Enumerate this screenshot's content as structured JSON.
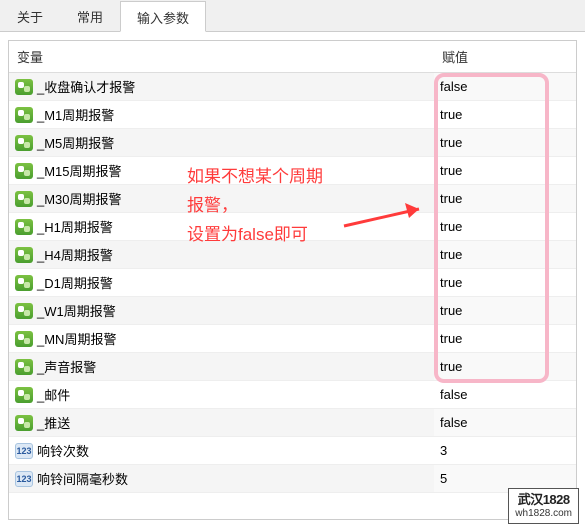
{
  "tabs": [
    {
      "label": "关于",
      "active": false
    },
    {
      "label": "常用",
      "active": false
    },
    {
      "label": "输入参数",
      "active": true
    }
  ],
  "columns": {
    "variable": "变量",
    "value": "赋值"
  },
  "rows": [
    {
      "type": "bool",
      "name": "_收盘确认才报警",
      "value": "false"
    },
    {
      "type": "bool",
      "name": "_M1周期报警",
      "value": "true"
    },
    {
      "type": "bool",
      "name": "_M5周期报警",
      "value": "true"
    },
    {
      "type": "bool",
      "name": "_M15周期报警",
      "value": "true"
    },
    {
      "type": "bool",
      "name": "_M30周期报警",
      "value": "true"
    },
    {
      "type": "bool",
      "name": "_H1周期报警",
      "value": "true"
    },
    {
      "type": "bool",
      "name": "_H4周期报警",
      "value": "true"
    },
    {
      "type": "bool",
      "name": "_D1周期报警",
      "value": "true"
    },
    {
      "type": "bool",
      "name": "_W1周期报警",
      "value": "true"
    },
    {
      "type": "bool",
      "name": "_MN周期报警",
      "value": "true"
    },
    {
      "type": "bool",
      "name": "_声音报警",
      "value": "true"
    },
    {
      "type": "bool",
      "name": "_邮件",
      "value": "false"
    },
    {
      "type": "bool",
      "name": "_推送",
      "value": "false"
    },
    {
      "type": "num",
      "name": "响铃次数",
      "value": "3"
    },
    {
      "type": "num",
      "name": "响铃间隔毫秒数",
      "value": "5"
    }
  ],
  "annotation": {
    "line1": "如果不想某个周期",
    "line2": "报警，",
    "line3": "设置为false即可"
  },
  "icon_num_text": "123",
  "watermark": {
    "brand": "武汉1828",
    "sub": "wh1828.com"
  }
}
